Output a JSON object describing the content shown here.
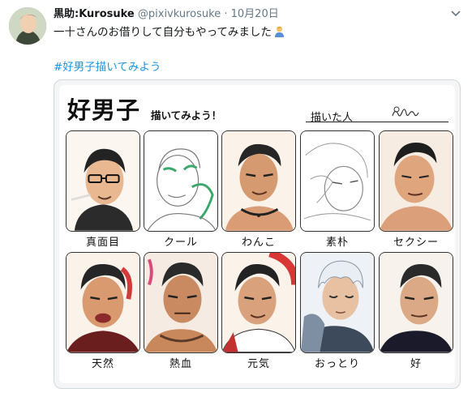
{
  "tweet": {
    "display_name": "黒助:Kurosuke",
    "handle": "@pixivkurosuke",
    "separator": "·",
    "date": "10月20日",
    "text": "一十さんのお借りして自分もやってみました",
    "hashtag": "#好男子描いてみよう"
  },
  "sheet": {
    "title": "好男子",
    "subtitle": "描いてみよう！",
    "artist_label": "描いた人",
    "cells": [
      {
        "label": "真面目"
      },
      {
        "label": "クール"
      },
      {
        "label": "わんこ"
      },
      {
        "label": "素朴"
      },
      {
        "label": "セクシー"
      },
      {
        "label": "天然"
      },
      {
        "label": "熱血"
      },
      {
        "label": "元気"
      },
      {
        "label": "おっとり"
      },
      {
        "label": "好"
      }
    ]
  },
  "colors": {
    "link": "#1b95e0",
    "muted": "#657786",
    "text": "#14171a"
  }
}
